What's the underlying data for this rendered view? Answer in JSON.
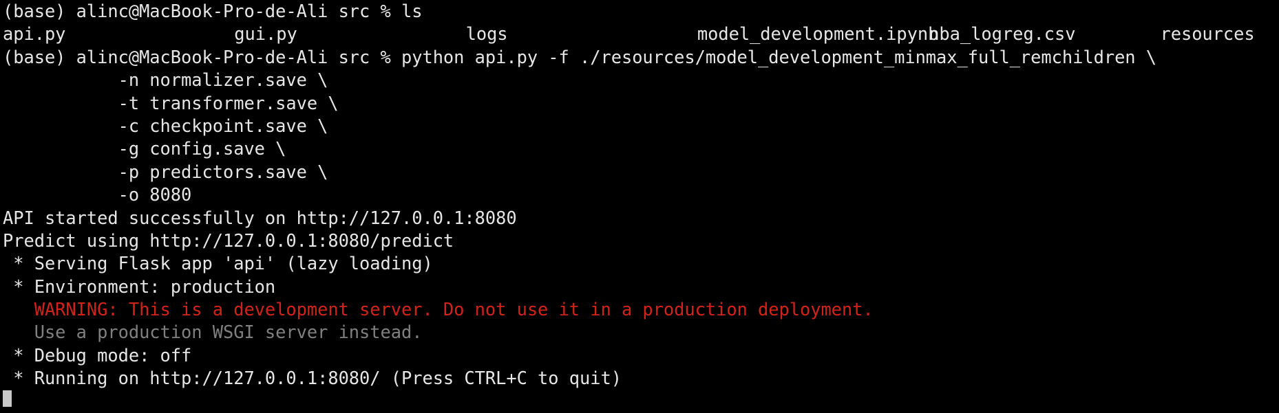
{
  "terminal": {
    "prompt1": "(base) alinc@MacBook-Pro-de-Ali src % ls",
    "ls_output": [
      "api.py",
      "gui.py",
      "logs",
      "model_development.ipynb",
      "nba_logreg.csv",
      "resources"
    ],
    "prompt2": "(base) alinc@MacBook-Pro-de-Ali src % python api.py -f ./resources/model_development_minmax_full_remchildren \\",
    "args": [
      "           -n normalizer.save \\",
      "           -t transformer.save \\",
      "           -c checkpoint.save \\",
      "           -g config.save \\",
      "           -p predictors.save \\",
      "           -o 8080"
    ],
    "api_started": "API started successfully on http://127.0.0.1:8080",
    "predict_using": "Predict using http://127.0.0.1:8080/predict",
    "serving": " * Serving Flask app 'api' (lazy loading)",
    "environment": " * Environment: production",
    "warning": "   WARNING: This is a development server. Do not use it in a production deployment.",
    "wsgi_hint": "   Use a production WSGI server instead.",
    "debug": " * Debug mode: off",
    "running": " * Running on http://127.0.0.1:8080/ (Press CTRL+C to quit)",
    "colors": {
      "warning": "#d2231b",
      "hint": "#808080",
      "text": "#e6e6e6",
      "background": "#000000"
    }
  }
}
